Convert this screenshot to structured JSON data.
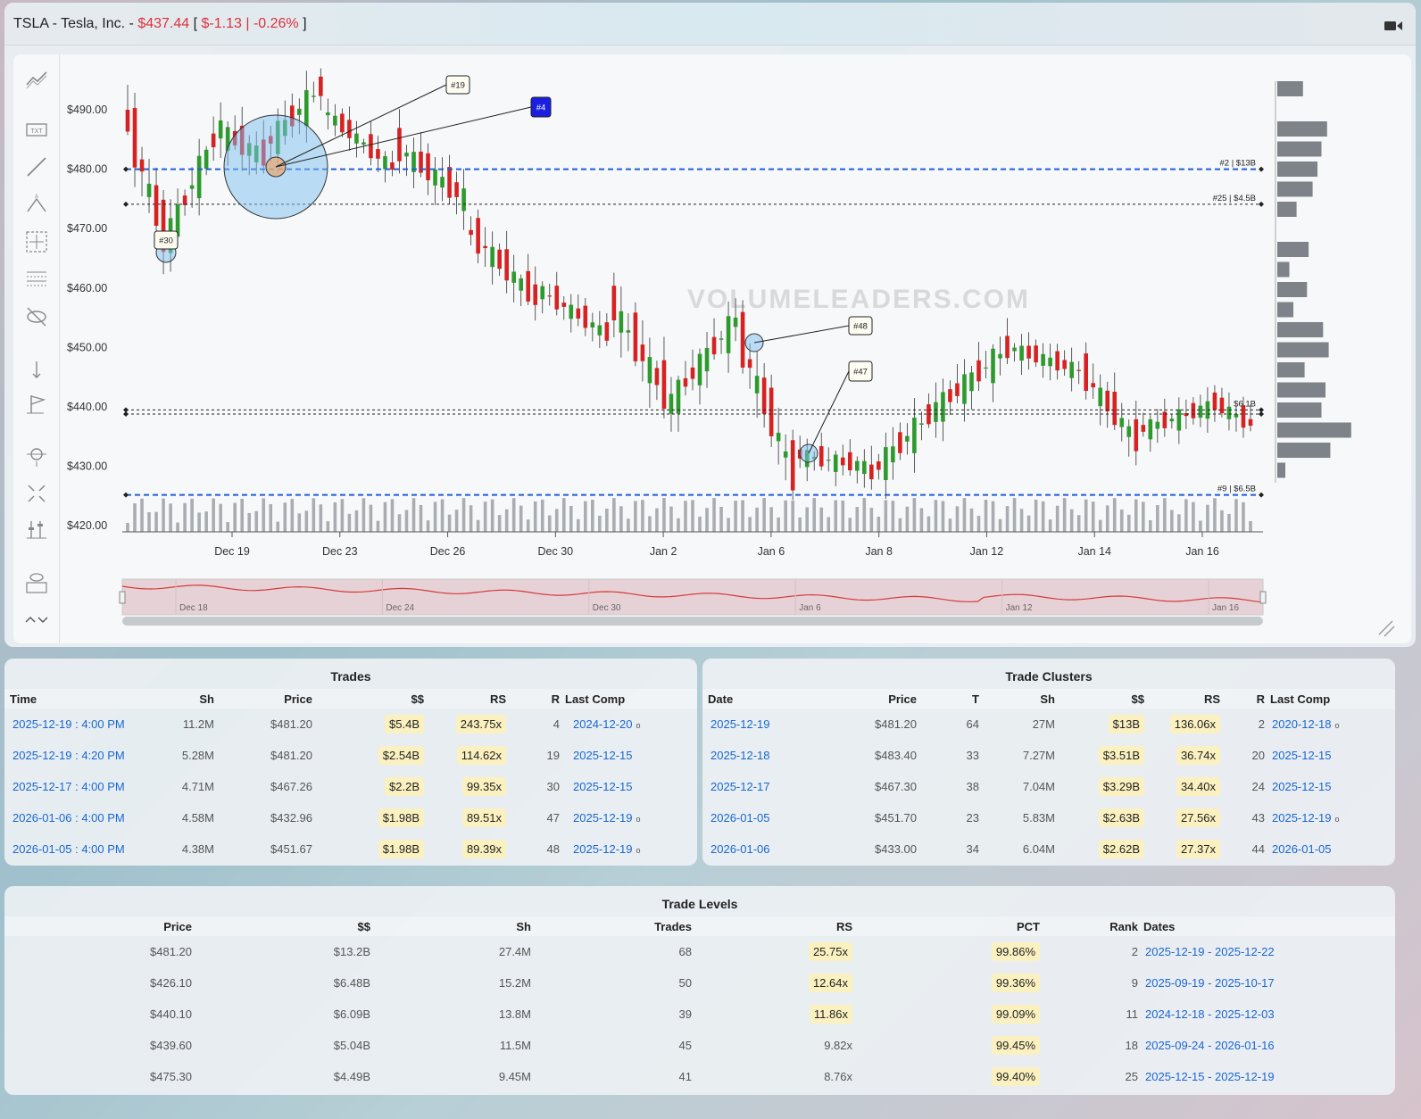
{
  "header": {
    "ticker_title": "TSLA - Tesla, Inc. -",
    "price": "$437.44",
    "open_bracket": "[",
    "change": "$-1.13 | -0.26%",
    "close_bracket": "]",
    "camera_icon": "video-camera-icon"
  },
  "toolbar": {
    "icons": [
      "trend-tools-icon",
      "text-icon",
      "line-icon",
      "pattern-icon",
      "crosshair-box-icon",
      "grid-lines-icon",
      "hide-icon",
      "measure-icon",
      "flag-icon",
      "zoom-icon",
      "fullscreen-icon",
      "adjust-icon",
      "visibility-icon",
      "scroll-icon"
    ]
  },
  "watermark": "VOLUMELEADERS.COM",
  "chart_data": {
    "type": "candlestick",
    "title": "",
    "ylim": [
      418,
      498
    ],
    "y_ticks": [
      "$490.00",
      "$480.00",
      "$470.00",
      "$460.00",
      "$450.00",
      "$440.00",
      "$430.00",
      "$420.00"
    ],
    "x_ticks": [
      "Dec 19",
      "Dec 23",
      "Dec 26",
      "Dec 30",
      "Jan 2",
      "Jan 6",
      "Jan 8",
      "Jan 12",
      "Jan 14",
      "Jan 16"
    ],
    "navigator_ticks": [
      "Dec 18",
      "Dec 24",
      "Dec 30",
      "Jan 6",
      "Jan 12",
      "Jan 16"
    ],
    "levels": [
      {
        "price": 480.0,
        "label": "#2 | $13B",
        "style": "blue"
      },
      {
        "price": 474.1,
        "label": "#25 | $4.5B",
        "style": "black"
      },
      {
        "price": 439.5,
        "label": "$6.1B",
        "style": "black"
      },
      {
        "price": 438.8,
        "label": "",
        "style": "black"
      },
      {
        "price": 425.2,
        "label": "#9 | $6.5B",
        "style": "blue"
      }
    ],
    "annotations": [
      {
        "label": "#19",
        "style": "white"
      },
      {
        "label": "#4",
        "style": "blue"
      },
      {
        "label": "#30",
        "style": "white"
      },
      {
        "label": "#48",
        "style": "white"
      },
      {
        "label": "#47",
        "style": "white"
      }
    ],
    "volume_profile": [
      0.32,
      0.0,
      0.62,
      0.55,
      0.5,
      0.44,
      0.24,
      0.0,
      0.39,
      0.15,
      0.37,
      0.2,
      0.57,
      0.64,
      0.34,
      0.6,
      0.55,
      0.92,
      0.66,
      0.1
    ]
  },
  "trades": {
    "title": "Trades",
    "columns": [
      "Time",
      "Sh",
      "Price",
      "$$",
      "RS",
      "R",
      "Last Comp"
    ],
    "rows": [
      {
        "time": "2025-12-19 : 4:00 PM",
        "sh": "11.2M",
        "price": "$481.20",
        "dollars": "$5.4B",
        "rs": "243.75x",
        "r": "4",
        "comp": "2024-12-20",
        "dot": "o"
      },
      {
        "time": "2025-12-19 : 4:20 PM",
        "sh": "5.28M",
        "price": "$481.20",
        "dollars": "$2.54B",
        "rs": "114.62x",
        "r": "19",
        "comp": "2025-12-15",
        "dot": ""
      },
      {
        "time": "2025-12-17 : 4:00 PM",
        "sh": "4.71M",
        "price": "$467.26",
        "dollars": "$2.2B",
        "rs": "99.35x",
        "r": "30",
        "comp": "2025-12-15",
        "dot": ""
      },
      {
        "time": "2026-01-06 : 4:00 PM",
        "sh": "4.58M",
        "price": "$432.96",
        "dollars": "$1.98B",
        "rs": "89.51x",
        "r": "47",
        "comp": "2025-12-19",
        "dot": "o"
      },
      {
        "time": "2026-01-05 : 4:00 PM",
        "sh": "4.38M",
        "price": "$451.67",
        "dollars": "$1.98B",
        "rs": "89.39x",
        "r": "48",
        "comp": "2025-12-19",
        "dot": "o"
      }
    ]
  },
  "clusters": {
    "title": "Trade Clusters",
    "columns": [
      "Date",
      "Price",
      "T",
      "Sh",
      "$$",
      "RS",
      "R",
      "Last Comp"
    ],
    "rows": [
      {
        "date": "2025-12-19",
        "price": "$481.20",
        "t": "64",
        "sh": "27M",
        "dollars": "$13B",
        "rs": "136.06x",
        "r": "2",
        "comp": "2020-12-18",
        "dot": "o"
      },
      {
        "date": "2025-12-18",
        "price": "$483.40",
        "t": "33",
        "sh": "7.27M",
        "dollars": "$3.51B",
        "rs": "36.74x",
        "r": "20",
        "comp": "2025-12-15",
        "dot": ""
      },
      {
        "date": "2025-12-17",
        "price": "$467.30",
        "t": "38",
        "sh": "7.04M",
        "dollars": "$3.29B",
        "rs": "34.40x",
        "r": "24",
        "comp": "2025-12-15",
        "dot": ""
      },
      {
        "date": "2026-01-05",
        "price": "$451.70",
        "t": "23",
        "sh": "5.83M",
        "dollars": "$2.63B",
        "rs": "27.56x",
        "r": "43",
        "comp": "2025-12-19",
        "dot": "o"
      },
      {
        "date": "2026-01-06",
        "price": "$433.00",
        "t": "34",
        "sh": "6.04M",
        "dollars": "$2.62B",
        "rs": "27.37x",
        "r": "44",
        "comp": "2026-01-05",
        "dot": ""
      }
    ]
  },
  "levels": {
    "title": "Trade Levels",
    "columns": [
      "Price",
      "$$",
      "Sh",
      "Trades",
      "RS",
      "PCT",
      "Rank",
      "Dates"
    ],
    "rows": [
      {
        "price": "$481.20",
        "dollars": "$13.2B",
        "sh": "27.4M",
        "trades": "68",
        "rs": "25.75x",
        "rs_pill": true,
        "pct": "99.86%",
        "rank": "2",
        "dates": "2025-12-19 - 2025-12-22"
      },
      {
        "price": "$426.10",
        "dollars": "$6.48B",
        "sh": "15.2M",
        "trades": "50",
        "rs": "12.64x",
        "rs_pill": true,
        "pct": "99.36%",
        "rank": "9",
        "dates": "2025-09-19 - 2025-10-17"
      },
      {
        "price": "$440.10",
        "dollars": "$6.09B",
        "sh": "13.8M",
        "trades": "39",
        "rs": "11.86x",
        "rs_pill": true,
        "pct": "99.09%",
        "rank": "11",
        "dates": "2024-12-18 - 2025-12-03"
      },
      {
        "price": "$439.60",
        "dollars": "$5.04B",
        "sh": "11.5M",
        "trades": "45",
        "rs": "9.82x",
        "rs_pill": false,
        "pct": "99.45%",
        "rank": "18",
        "dates": "2025-09-24 - 2026-01-16"
      },
      {
        "price": "$475.30",
        "dollars": "$4.49B",
        "sh": "9.45M",
        "trades": "41",
        "rs": "8.76x",
        "rs_pill": false,
        "pct": "99.40%",
        "rank": "25",
        "dates": "2025-12-15 - 2025-12-19"
      }
    ]
  }
}
